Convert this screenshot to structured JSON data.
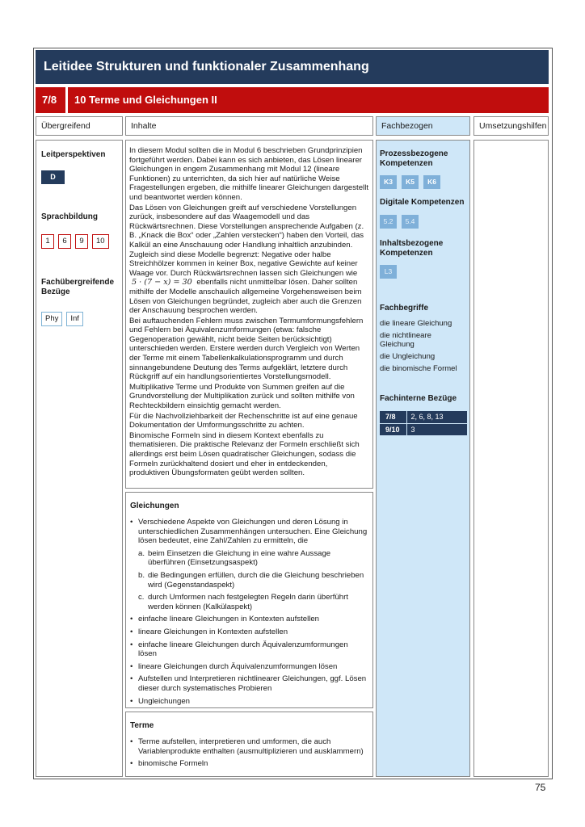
{
  "header": {
    "title": "Leitidee Strukturen und funktionaler Zusammenhang",
    "grade": "7/8",
    "module_title": "10 Terme und Gleichungen II"
  },
  "columns": {
    "uebergreifend": "Übergreifend",
    "inhalte": "Inhalte",
    "fachbezogen": "Fachbezogen",
    "umsetzungshilfen": "Umsetzungshilfen"
  },
  "left": {
    "leitperspektiven_title": "Leitperspektiven",
    "leitperspektiven_tag": "D",
    "sprachbildung_title": "Sprachbildung",
    "sprachbildung_tags": [
      "1",
      "6",
      "9",
      "10"
    ],
    "faecher_title": "Fachübergreifende Bezüge",
    "faecher_tags": [
      "Phy",
      "Inf"
    ]
  },
  "fach": {
    "prozess_title": "Prozessbezogene Kompetenzen",
    "prozess_tags": [
      "K3",
      "K5",
      "K6"
    ],
    "digital_title": "Digitale Kompetenzen",
    "digital_tags": [
      "5.2",
      "5.4"
    ],
    "inhalt_title": "Inhaltsbezogene Kompetenzen",
    "inhalt_tags": [
      "L3"
    ],
    "begriffe_title": "Fachbegriffe",
    "begriffe": [
      "die lineare Gleichung",
      "die nichtlineare Gleichung",
      "die Ungleichung",
      "die binomische Formel"
    ],
    "intern_title": "Fachinterne Bezüge",
    "intern_rows": [
      {
        "grade": "7/8",
        "refs": "2, 6, 8, 13"
      },
      {
        "grade": "9/10",
        "refs": "3"
      }
    ]
  },
  "intro": {
    "p1": "In diesem Modul sollten die in Modul 6 beschrieben Grundprinzipien fortgeführt werden. Dabei kann es sich anbieten, das Lösen linearer Gleichungen in engem Zusammenhang mit Modul 12 (lineare Funktionen) zu unterrichten, da sich hier auf natürliche Weise Fragestellungen ergeben, die mithilfe linearer Gleichungen dargestellt und beantwortet werden können.",
    "p2a": "Das Lösen von Gleichungen greift auf verschiedene Vorstellungen zurück, insbesondere auf das Waagemodell und das Rückwärtsrechnen. Diese Vorstellungen ansprechende Aufgaben (z. B. „Knack die Box“ oder „Zahlen verstecken“) haben den Vorteil, das Kalkül an eine Anschauung oder Handlung inhaltlich anzubinden. Zugleich sind diese Modelle begrenzt: Negative oder halbe Streichhölzer kommen in keiner Box, negative Gewichte auf keiner Waage vor. Durch Rückwärtsrechnen lassen sich Gleichungen wie",
    "formula": "5 · (7 − x) = 30",
    "p2b": "ebenfalls nicht unmittelbar lösen. Daher sollten mithilfe der Modelle anschaulich allgemeine Vorgehensweisen beim Lösen von Gleichungen begründet, zugleich aber auch die Grenzen der Anschauung besprochen werden.",
    "p3": "Bei auftauchenden Fehlern muss zwischen Termumformungsfehlern und Fehlern bei Äquivalenzumformungen (etwa: falsche Gegenoperation gewählt, nicht beide Seiten berücksichtigt) unterschieden werden. Erstere werden durch Vergleich von Werten der Terme mit einem Tabellenkalkulationsprogramm und durch sinnangebundene Deutung des Terms aufgeklärt, letztere durch Rückgriff auf ein handlungsorientiertes Vorstellungsmodell.",
    "p4": "Multiplikative Terme und Produkte von Summen greifen auf die Grundvorstellung der Multiplikation zurück und sollten mithilfe von Rechteckbildern einsichtig gemacht werden.",
    "p5": "Für die Nachvollziehbarkeit der Rechenschritte ist auf eine genaue Dokumentation der Umformungsschritte zu achten.",
    "p6": "Binomische Formeln sind in diesem Kontext ebenfalls zu thematisieren. Die praktische Relevanz der Formeln erschließt sich allerdings erst beim Lösen quadratischer Gleichungen, sodass die Formeln zurückhaltend dosiert und eher in entdeckenden, produktiven Übungsformaten geübt werden sollten."
  },
  "gleichungen": {
    "title": "Gleichungen",
    "first": "Verschiedene Aspekte von Gleichungen und deren Lösung in unterschiedlichen Zusammenhängen untersuchen. Eine Gleichung lösen bedeutet, eine Zahl/Zahlen zu ermitteln, die",
    "sub": [
      {
        "letter": "a.",
        "text": "beim Einsetzen die Gleichung in eine wahre Aussage überführen (Einsetzungsaspekt)"
      },
      {
        "letter": "b.",
        "text": "die Bedingungen erfüllen, durch die die Gleichung beschrieben wird (Gegenstandaspekt)"
      },
      {
        "letter": "c.",
        "text": "durch Umformen nach festgelegten Regeln darin überführt werden können (Kalkülaspekt)"
      }
    ],
    "items": [
      "einfache lineare Gleichungen in Kontexten aufstellen",
      "lineare Gleichungen in Kontexten aufstellen",
      "einfache lineare Gleichungen durch Äquivalenzumformungen lösen",
      "lineare Gleichungen durch Äquivalenzumformungen lösen",
      "Aufstellen und Interpretieren nichtlinearer Gleichungen, ggf. Lösen dieser durch systematisches Probieren",
      "Ungleichungen"
    ]
  },
  "terme": {
    "title": "Terme",
    "items": [
      "Terme aufstellen, interpretieren und umformen, die auch Variablenprodukte enthalten (ausmultiplizieren und ausklammern)",
      "binomische Formeln"
    ]
  },
  "page_number": "75",
  "colors": {
    "navy": "#243b5c",
    "red": "#c00d0d",
    "light_blue": "#cfe7f8",
    "chip_blue": "#7fb0d9"
  }
}
